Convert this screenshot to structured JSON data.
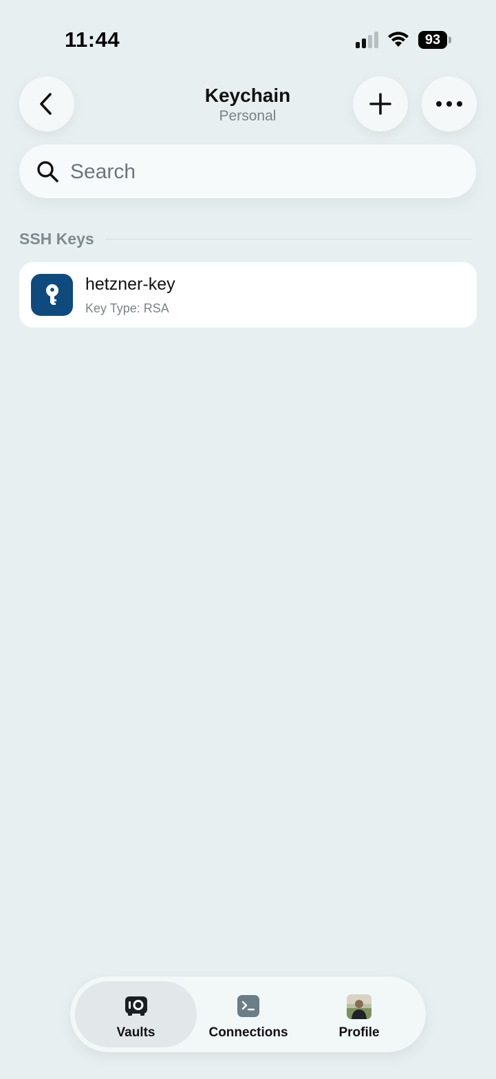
{
  "status_bar": {
    "time": "11:44",
    "battery": "93",
    "icons": [
      "signal-icon",
      "wifi-icon",
      "battery-icon"
    ]
  },
  "header": {
    "title": "Keychain",
    "subtitle": "Personal",
    "icons": {
      "back": "chevron-left-icon",
      "add": "plus-icon",
      "more": "ellipsis-icon"
    }
  },
  "search": {
    "placeholder": "Search",
    "value": "",
    "icon": "search-icon"
  },
  "section": {
    "title": "SSH Keys"
  },
  "keys": [
    {
      "name": "hetzner-key",
      "type": "Key Type: RSA",
      "icon": "key-icon",
      "icon_color": "#0e4a7d"
    }
  ],
  "tab_bar": {
    "tabs": [
      {
        "label": "Vaults",
        "icon": "vault-icon",
        "selected": true
      },
      {
        "label": "Connections",
        "icon": "terminal-icon",
        "selected": false
      },
      {
        "label": "Profile",
        "icon": "avatar",
        "selected": false
      }
    ]
  },
  "colors": {
    "background": "#e8eff0",
    "accent": "#0e4a7d",
    "card": "#ffffff"
  }
}
